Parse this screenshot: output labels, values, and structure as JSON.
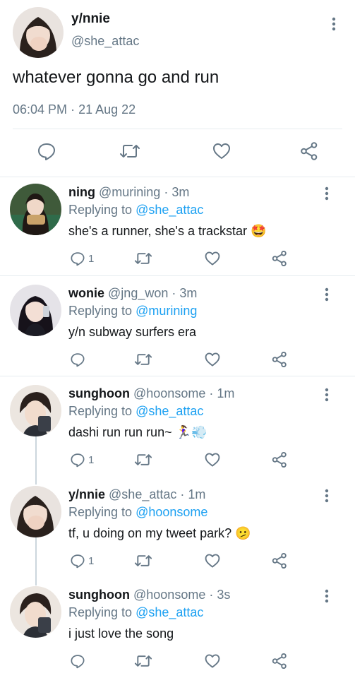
{
  "main_tweet": {
    "name": "y/nnie",
    "handle": "@she_attac",
    "text": "whatever gonna go and run",
    "time": "06:04 PM",
    "date_sep": "·",
    "date": "21 Aug 22"
  },
  "replies": [
    {
      "name": "ning",
      "handle": "@murining · 3m",
      "replying_label": "Replying to",
      "replying_to": "@she_attac",
      "text": "she's a runner, she's a trackstar 🤩",
      "reply_count": "1"
    },
    {
      "name": "wonie",
      "handle": "@jng_won · 3m",
      "replying_label": "Replying to",
      "replying_to": "@murining",
      "text": "y/n subway surfers era",
      "reply_count": ""
    },
    {
      "name": "sunghoon",
      "handle": "@hoonsome · 1m",
      "replying_label": "Replying to",
      "replying_to": "@she_attac",
      "text": "dashi run run run~ 🏃‍♀️💨",
      "reply_count": "1"
    },
    {
      "name": "y/nnie",
      "handle": "@she_attac · 1m",
      "replying_label": "Replying to",
      "replying_to": "@hoonsome",
      "text": "tf, u doing on my tweet park? 🫤",
      "reply_count": "1"
    },
    {
      "name": "sunghoon",
      "handle": "@hoonsome · 3s",
      "replying_label": "Replying to",
      "replying_to": "@she_attac",
      "text": "i just love the song",
      "reply_count": ""
    }
  ],
  "icons": {
    "reply": "reply-icon",
    "retweet": "retweet-icon",
    "like": "heart-icon",
    "share": "share-icon",
    "more": "more-vertical-icon"
  },
  "colors": {
    "text": "#14171a",
    "secondary": "#657786",
    "link": "#1da1f2",
    "divider": "#e6ecf0"
  }
}
